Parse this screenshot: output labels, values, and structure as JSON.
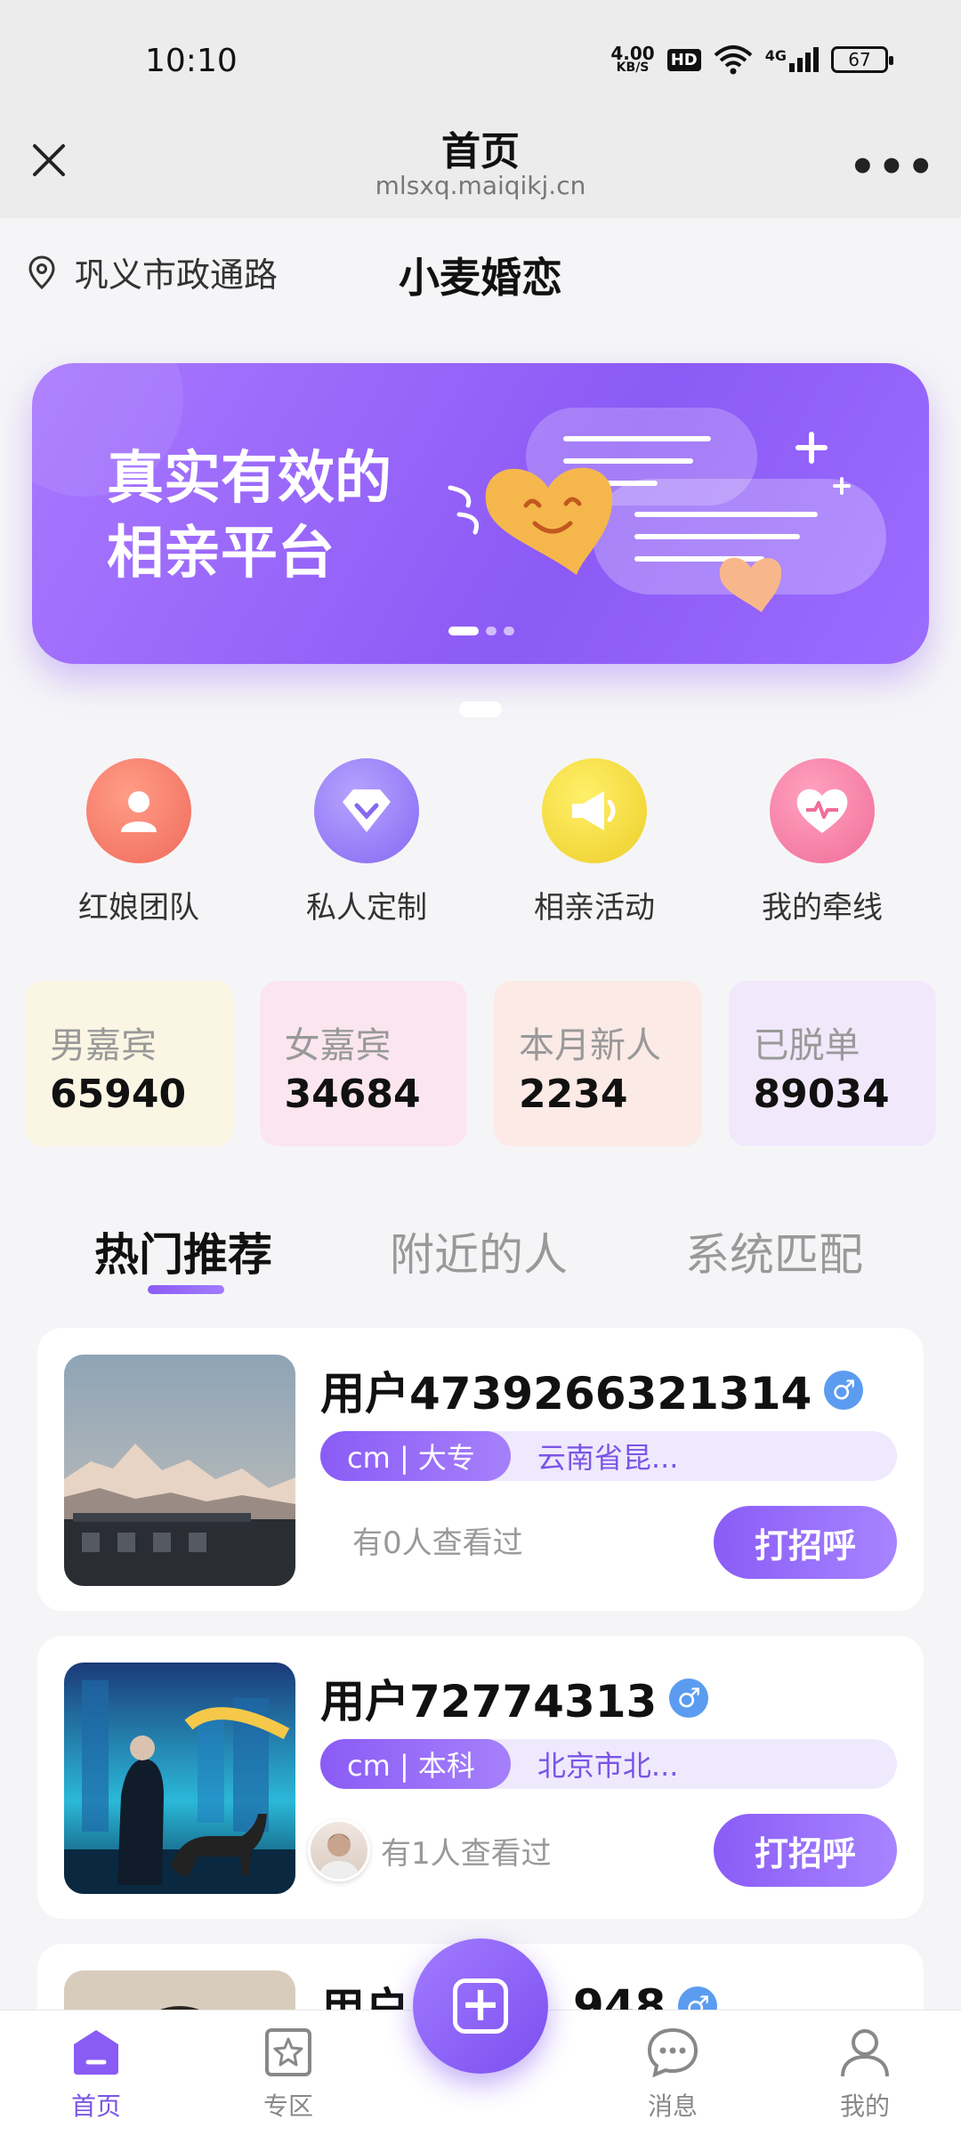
{
  "status_bar": {
    "time": "10:10",
    "net_speed_value": "4.00",
    "net_speed_unit": "KB/S",
    "hd": "HD",
    "network": "4G",
    "battery": "67"
  },
  "title_bar": {
    "close_icon": "close-icon",
    "title": "首页",
    "url": "mlsxq.maiqikj.cn",
    "more_label": "•••"
  },
  "header": {
    "location": "巩义市政通路",
    "brand": "小麦婚恋"
  },
  "banner": {
    "line1": "真实有效的",
    "line2": "相亲平台",
    "accent": "#9466f7"
  },
  "quick_menu": [
    {
      "label": "红娘团队",
      "icon": "person-icon",
      "color": "#f47a6a"
    },
    {
      "label": "私人定制",
      "icon": "diamond-icon",
      "color": "#9278f5"
    },
    {
      "label": "相亲活动",
      "icon": "megaphone-icon",
      "color": "#f0d43a"
    },
    {
      "label": "我的牵线",
      "icon": "heart-pulse-icon",
      "color": "#f57aa0"
    }
  ],
  "stats": [
    {
      "label": "男嘉宾",
      "value": "65940",
      "bg": "#fbf6e4"
    },
    {
      "label": "女嘉宾",
      "value": "34684",
      "bg": "#fbe6ef"
    },
    {
      "label": "本月新人",
      "value": "2234",
      "bg": "#fbeae6"
    },
    {
      "label": "已脱单",
      "value": "89034",
      "bg": "#f1e9fb"
    }
  ],
  "tabs": [
    "热门推荐",
    "附近的人",
    "系统匹配"
  ],
  "users": [
    {
      "name": "用户4739266321314",
      "tag_left": "cm | 大专",
      "tag_right": "云南省昆...",
      "viewers": "有0人查看过",
      "greet": "打招呼"
    },
    {
      "name": "用户72774313",
      "tag_left": "cm | 本科",
      "tag_right": "北京市北...",
      "viewers": "有1人查看过",
      "greet": "打招呼"
    },
    {
      "name": "用户",
      "name_tail": "948"
    }
  ],
  "bottom_nav": {
    "home": "首页",
    "zone": "专区",
    "messages": "消息",
    "mine": "我的"
  }
}
